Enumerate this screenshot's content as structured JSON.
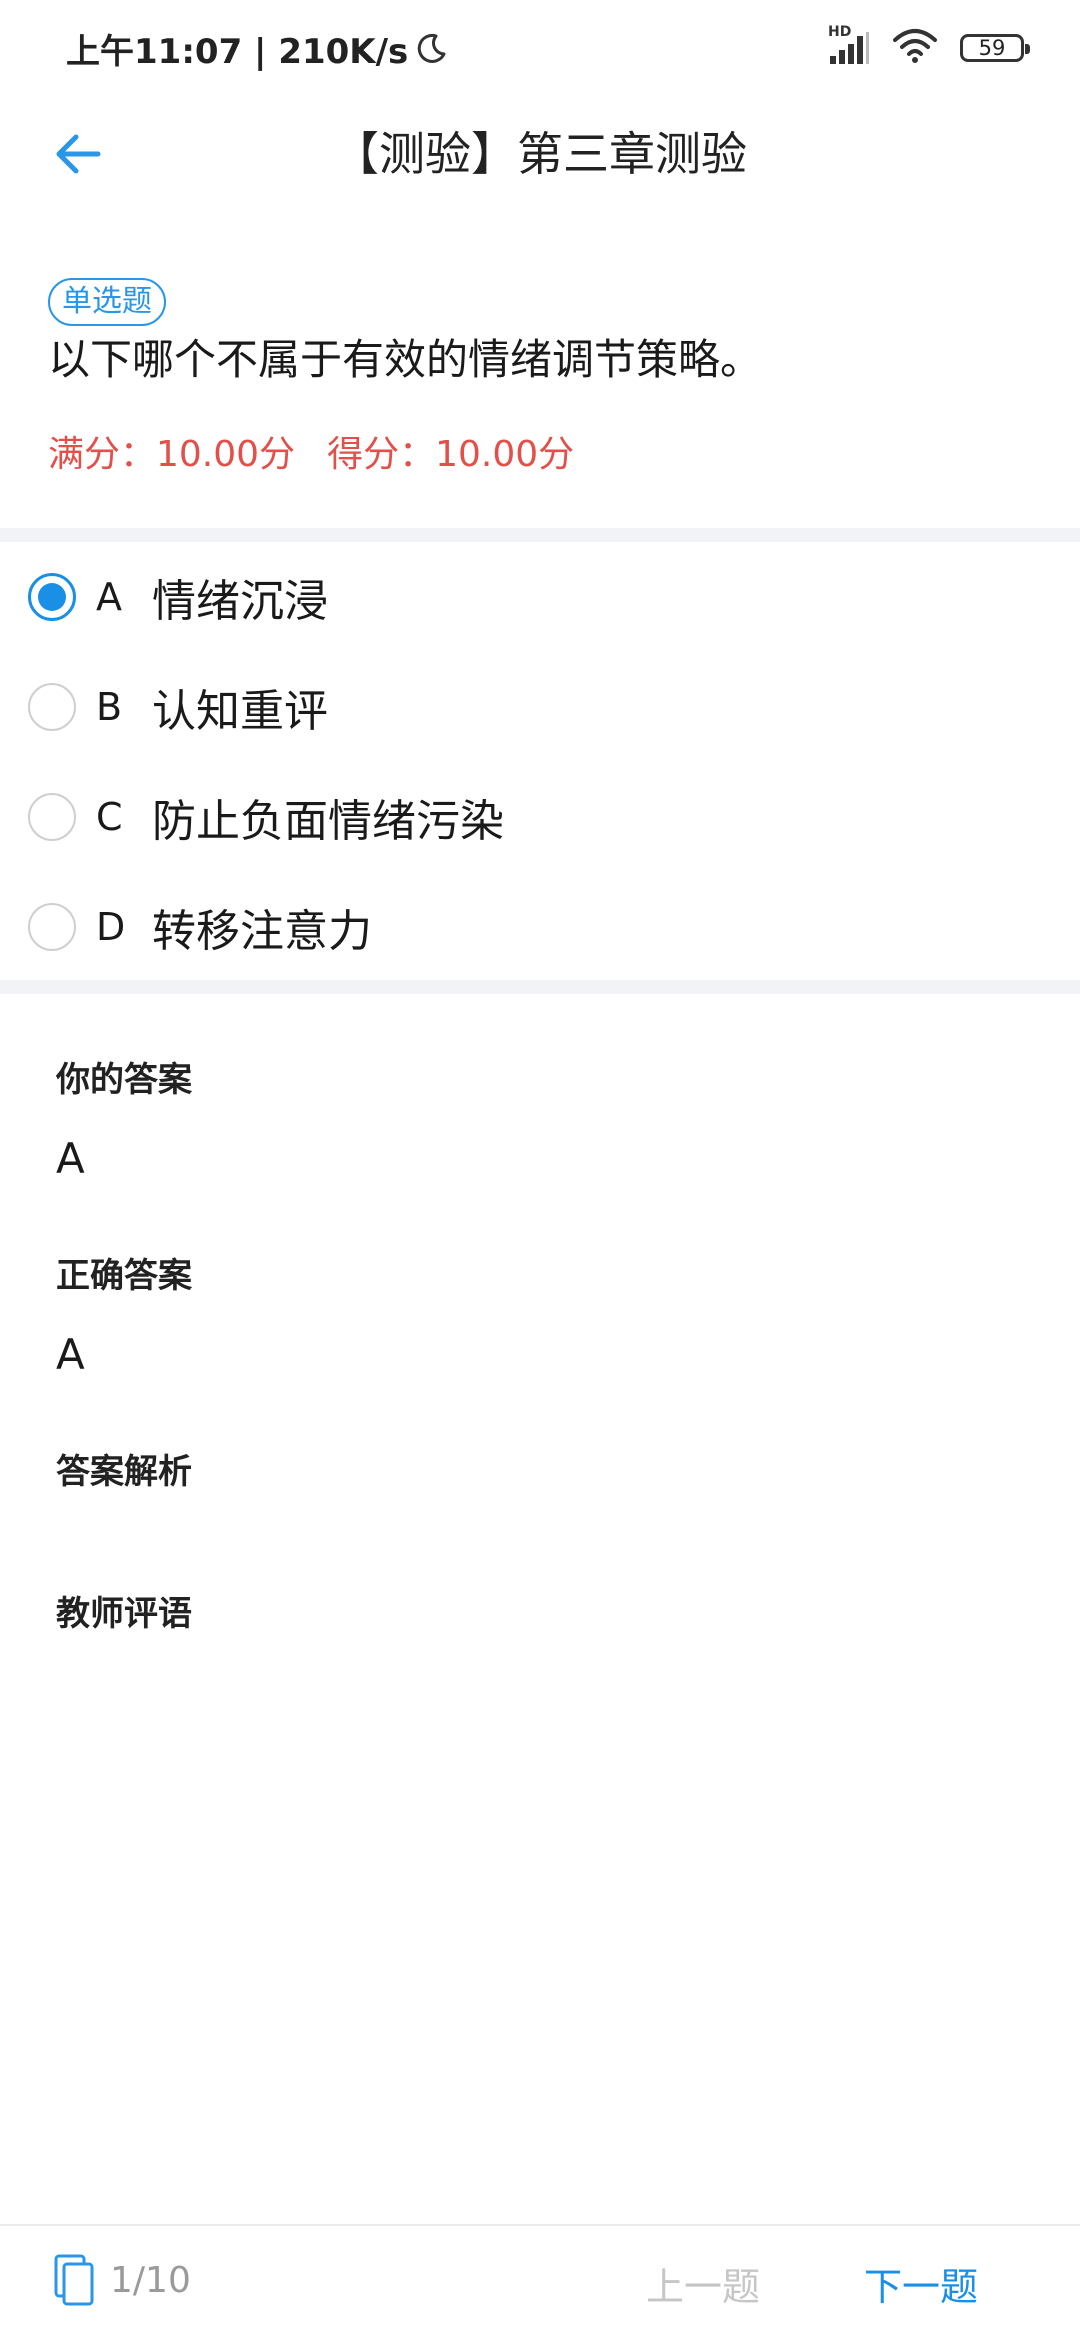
{
  "status_bar": {
    "time_speed": "上午11:07 | 210K/s",
    "network_label": "HD",
    "battery_level": "59"
  },
  "header": {
    "title": "【测验】第三章测验"
  },
  "question": {
    "type_badge": "单选题",
    "text": "以下哪个不属于有效的情绪调节策略。",
    "full_score": "满分：10.00分",
    "obtained_score": "得分：10.00分"
  },
  "options": [
    {
      "letter": "A",
      "text": "情绪沉浸",
      "selected": true
    },
    {
      "letter": "B",
      "text": "认知重评",
      "selected": false
    },
    {
      "letter": "C",
      "text": "防止负面情绪污染",
      "selected": false
    },
    {
      "letter": "D",
      "text": "转移注意力",
      "selected": false
    }
  ],
  "answer": {
    "your_answer_label": "你的答案",
    "your_answer_value": "A",
    "correct_answer_label": "正确答案",
    "correct_answer_value": "A",
    "analysis_label": "答案解析",
    "teacher_comment_label": "教师评语"
  },
  "bottom_bar": {
    "page_count": "1/10",
    "prev_label": "上一题",
    "next_label": "下一题"
  },
  "colors": {
    "accent": "#1a8fe6",
    "score_red": "#e2504a",
    "divider": "#f1f3f6",
    "disabled": "#c6c6c6"
  }
}
